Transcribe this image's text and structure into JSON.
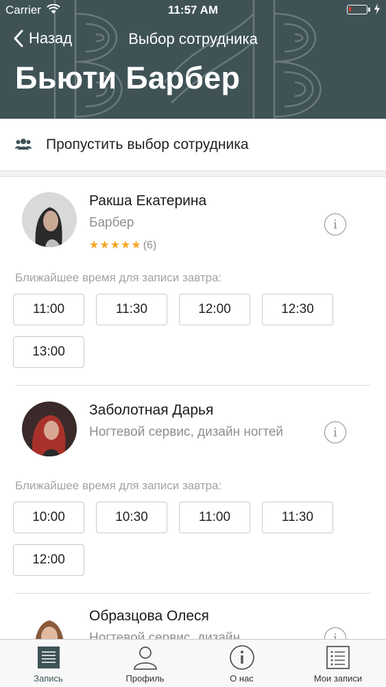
{
  "status_bar": {
    "carrier": "Carrier",
    "time": "11:57 AM",
    "battery_level": 0.15,
    "battery_color": "#e23b2e"
  },
  "nav": {
    "back_label": "Назад",
    "title": "Выбор сотрудника"
  },
  "salon": {
    "name": "Бьюти Барбер"
  },
  "skip": {
    "label": "Пропустить выбор сотрудника",
    "icon": "users-icon"
  },
  "employees": [
    {
      "name": "Ракша Екатерина",
      "role": "Барбер",
      "rating_stars": 5,
      "rating_count": "(6)",
      "nearest_label": "Ближайшее время для записи завтра:",
      "slots": [
        "11:00",
        "11:30",
        "12:00",
        "12:30",
        "13:00"
      ]
    },
    {
      "name": "Заболотная Дарья",
      "role": "Ногтевой сервис, дизайн ногтей",
      "nearest_label": "Ближайшее время для записи завтра:",
      "slots": [
        "10:00",
        "10:30",
        "11:00",
        "11:30",
        "12:00"
      ]
    },
    {
      "name": "Образцова Олеся",
      "role": "Ногтевой сервис, дизайн"
    }
  ],
  "tabbar": {
    "items": [
      {
        "label": "Запись",
        "icon": "booking-list-icon",
        "active": true
      },
      {
        "label": "Профиль",
        "icon": "profile-icon",
        "active": false
      },
      {
        "label": "О нас",
        "icon": "info-icon",
        "active": false
      },
      {
        "label": "Мои записи",
        "icon": "my-bookings-icon",
        "active": false
      }
    ]
  },
  "colors": {
    "header_bg": "#3f5357",
    "star": "#f5a623",
    "muted_text": "#8e8e93"
  }
}
